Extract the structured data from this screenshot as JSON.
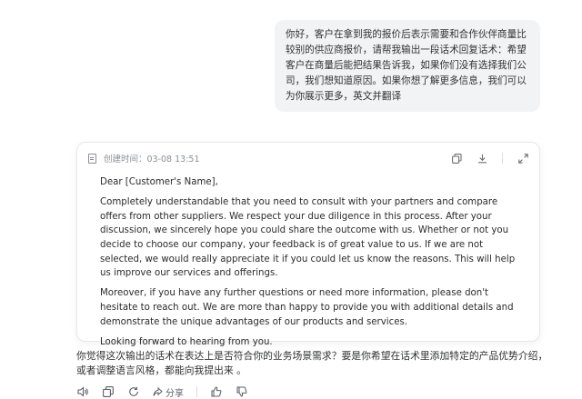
{
  "user_message": "你好，客户在拿到我的报价后表示需要和合作伙伴商量比较别的供应商报价，请帮我输出一段话术回复话术：希望客户在商量后能把结果告诉我，如果你们没有选择我们公司，我们想知道原因。如果你想了解更多信息，我们可以为你展示更多，英文并翻译",
  "card": {
    "created_label": "创建时间：03-08 13:51",
    "paragraphs": [
      "Dear [Customer's Name],",
      "Completely understandable that you need to consult with your partners and compare offers from other suppliers. We respect your due diligence in this process. After your discussion, we sincerely hope you could share the outcome with us. Whether or not you decide to choose our company, your feedback is of great value to us. If we are not selected, we would really appreciate it if you could let us know the reasons. This will help us improve our services and offerings.",
      "Moreover, if you have any further questions or need more information, please don't hesitate to reach out. We are more than happy to provide you with additional details and demonstrate the unique advantages of our products and services.",
      "Looking forward to hearing from you."
    ],
    "icons": [
      "copy-icon",
      "download-icon",
      "expand-icon"
    ]
  },
  "reply_text": "你觉得这次输出的话术在表达上是否符合你的业务场景需求？要是你希望在话术里添加特定的产品优势介绍，或者调整语言风格，都能向我提出来 。",
  "actions": {
    "share_label": "分享",
    "icons": [
      "speaker-icon",
      "copy-icon",
      "refresh-icon",
      "share-icon",
      "thumbs-up-icon",
      "thumbs-down-icon"
    ]
  }
}
